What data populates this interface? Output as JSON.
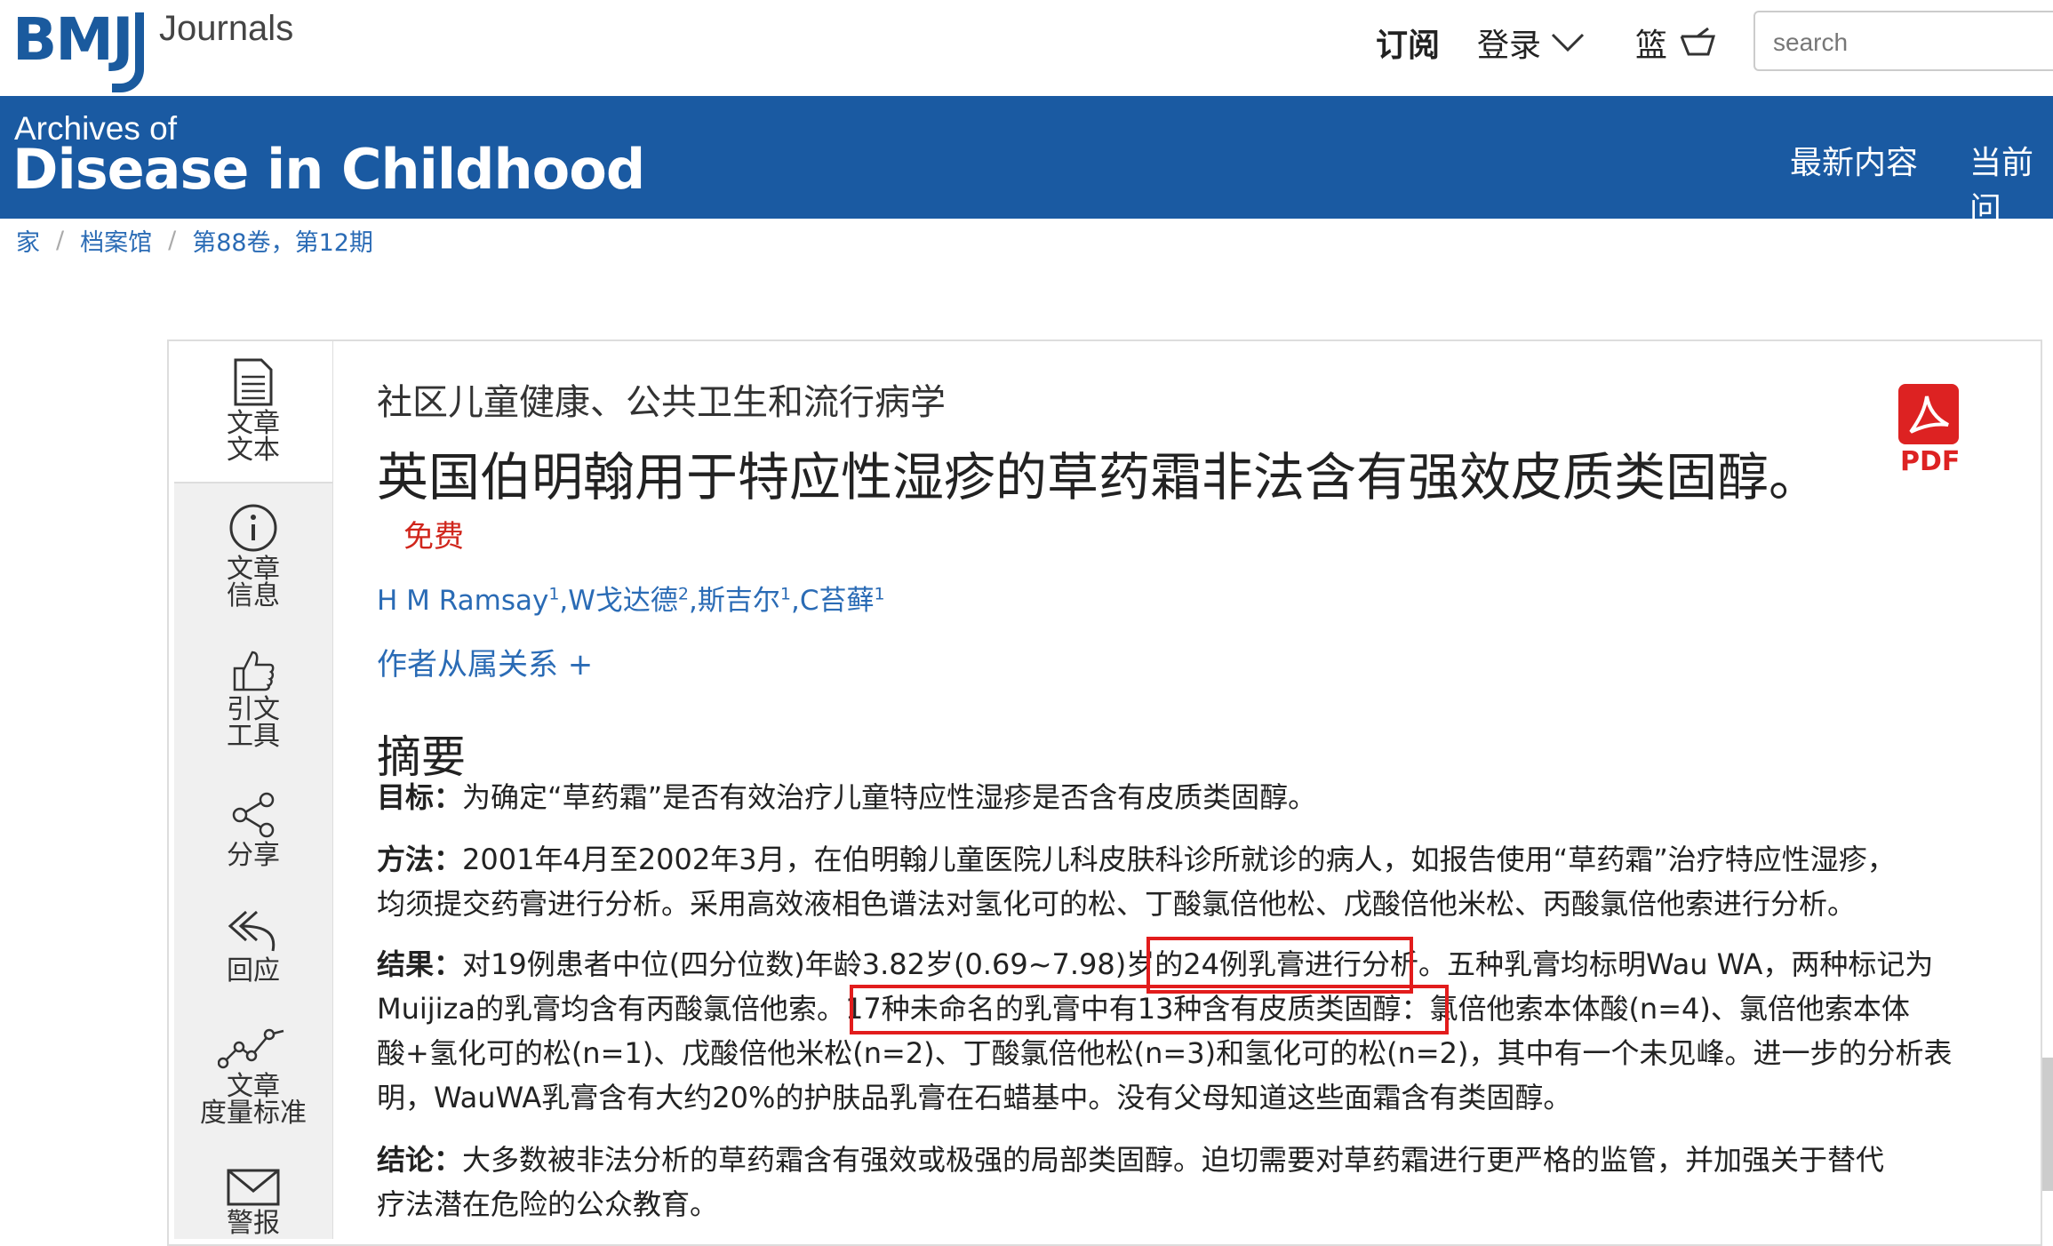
{
  "header": {
    "logo_bmj": "BMJ",
    "logo_journals": "Journals",
    "subscribe": "订阅",
    "login": "登录",
    "basket": "篮",
    "search_placeholder": "search"
  },
  "banner": {
    "archives": "Archives of",
    "title": "Disease in Childhood",
    "nav": [
      "最新内容",
      "当前问"
    ]
  },
  "breadcrumb": [
    "家",
    "档案馆",
    "第88卷，第12期"
  ],
  "sidebar": {
    "items": [
      {
        "line1": "文章",
        "line2": "文本",
        "icon": "document-icon"
      },
      {
        "line1": "文章",
        "line2": "信息",
        "icon": "info-icon"
      },
      {
        "line1": "引文",
        "line2": "工具",
        "icon": "thumbs-up-icon"
      },
      {
        "line1": "分享",
        "line2": "",
        "icon": "share-icon"
      },
      {
        "line1": "回应",
        "line2": "",
        "icon": "reply-icon"
      },
      {
        "line1": "文章",
        "line2": "度量标准",
        "icon": "metrics-icon"
      },
      {
        "line1": "警报",
        "line2": "",
        "icon": "envelope-icon"
      }
    ]
  },
  "article": {
    "subject": "社区儿童健康、公共卫生和流行病学",
    "title": "英国伯明翰用于特应性湿疹的草药霜非法含有强效皮质类固醇。",
    "access": "免费",
    "pdf_label": "PDF",
    "authors": [
      {
        "name": "H M Ramsay",
        "sup": "1"
      },
      {
        "name": "W戈达德",
        "sup": "2"
      },
      {
        "name": "斯吉尔",
        "sup": "1"
      },
      {
        "name": "C苔藓",
        "sup": "1"
      }
    ],
    "affiliations": "作者从属关系 +",
    "abstract_heading": "摘要",
    "objective_label": "目标：",
    "objective_text": "为确定“草药霜”是否有效治疗儿童特应性湿疹是否含有皮质类固醇。",
    "methods_label": "方法：",
    "methods_line1": "2001年4月至2002年3月，在伯明翰儿童医院儿科皮肤科诊所就诊的病人，如报告使用“草药霜”治疗特应性湿疹，",
    "methods_line2": "均须提交药膏进行分析。采用高效液相色谱法对氢化可的松、丁酸氯倍他松、戊酸倍他米松、丙酸氯倍他索进行分析。",
    "results_label": "结果：",
    "results_line1a": "对19例患者中位(四分位数)年龄3.82岁(0.69~7.98)岁的",
    "results_line1b": "24例乳膏进行分析",
    "results_line1c": "。五种乳膏均标明Wau WA，两种标记为",
    "results_line2a": "Muijiza的乳膏均含有丙酸氯倍他索。",
    "results_line2b": "17种未命名的乳膏中有13种含有皮质类固醇",
    "results_line2c": "：氯倍他索本体酸(n=4)、氯倍他索本体",
    "results_line3": "酸+氢化可的松(n=1)、戊酸倍他米松(n=2)、丁酸氯倍他松(n=3)和氢化可的松(n=2)，其中有一个未见峰。进一步的分析表",
    "results_line4": "明，WauWA乳膏含有大约20%的护肤品乳膏在石蜡基中。没有父母知道这些面霜含有类固醇。",
    "conclusions_label": "结论：",
    "conclusions_line1": "大多数被非法分析的草药霜含有强效或极强的局部类固醇。迫切需要对草药霜进行更严格的监管，并加强关于替代",
    "conclusions_line2": "疗法潜在危险的公众教育。"
  },
  "colors": {
    "brand_blue": "#1a5aa2",
    "link_blue": "#2a6bb5",
    "highlight_red": "#e21c1c",
    "free_red": "#d0261c"
  }
}
